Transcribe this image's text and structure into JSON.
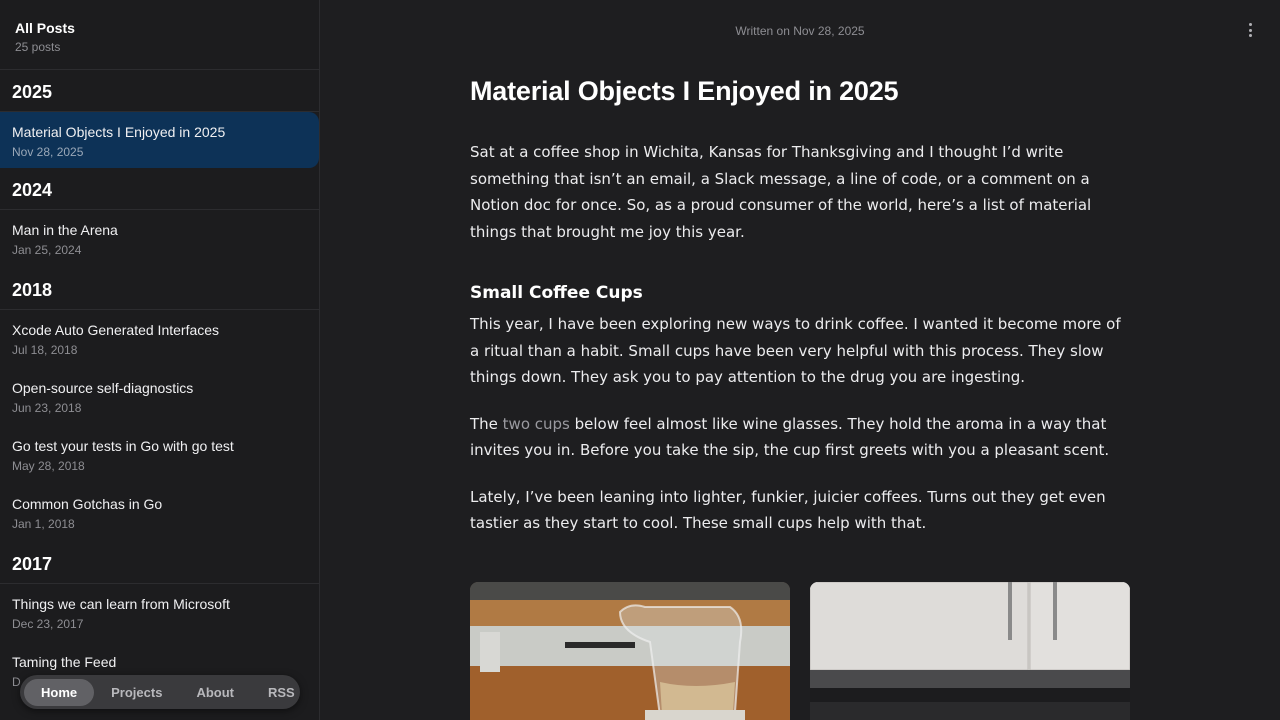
{
  "sidebar": {
    "title": "All Posts",
    "count": "25 posts",
    "groups": [
      {
        "year": "2025",
        "posts": [
          {
            "title": "Material Objects I Enjoyed in 2025",
            "date": "Nov 28, 2025"
          }
        ]
      },
      {
        "year": "2024",
        "posts": [
          {
            "title": "Man in the Arena",
            "date": "Jan 25, 2024"
          }
        ]
      },
      {
        "year": "2018",
        "posts": [
          {
            "title": "Xcode Auto Generated Interfaces",
            "date": "Jul 18, 2018"
          },
          {
            "title": "Open-source self-diagnostics",
            "date": "Jun 23, 2018"
          },
          {
            "title": "Go test your tests in Go with go test",
            "date": "May 28, 2018"
          },
          {
            "title": "Common Gotchas in Go",
            "date": "Jan 1, 2018"
          }
        ]
      },
      {
        "year": "2017",
        "posts": [
          {
            "title": "Things we can learn from Microsoft",
            "date": "Dec 23, 2017"
          },
          {
            "title": "Taming the Feed",
            "date": "D"
          }
        ]
      }
    ]
  },
  "nav": {
    "home": "Home",
    "projects": "Projects",
    "about": "About",
    "rss": "RSS"
  },
  "article": {
    "written_on": "Written on Nov 28, 2025",
    "title": "Material Objects I Enjoyed in 2025",
    "intro": "Sat at a coffee shop in Wichita, Kansas for Thanksgiving and I thought I’d write something that isn’t an email, a Slack message, a line of code, or a comment on a Notion doc for once. So, as a proud consumer of the world, here’s a list of material things that brought me joy this year.",
    "section_heading": "Small Coffee Cups",
    "para1": "This year, I have been exploring new ways to drink coffee. I wanted it become more of a ritual than a habit. Small cups have been very helpful with this process. They slow things down. They ask you to pay attention to the drug you are ingesting.",
    "para2_before": "The ",
    "para2_link": "two cups",
    "para2_after": " below feel almost like wine glasses. They hold the aroma in a way that invites you in. Before you take the sip, the cup first greets with you a pleasant scent.",
    "para3": "Lately, I’ve been leaning into lighter, funkier, juicier coffees. Turns out they get even tastier as they start to cool. These small cups help with that."
  }
}
